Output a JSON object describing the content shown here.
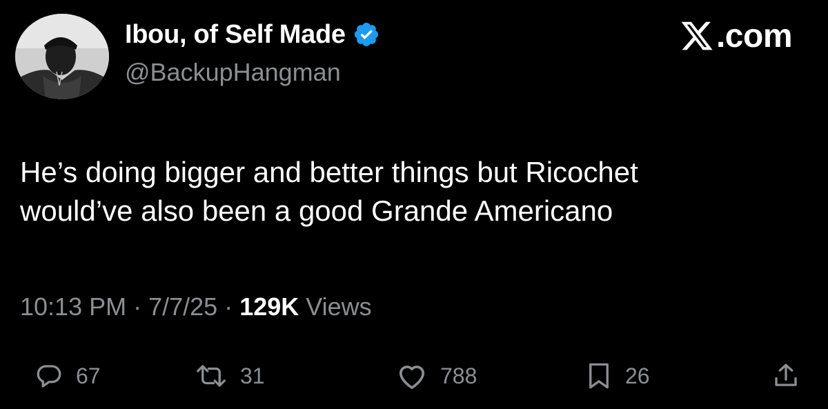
{
  "author": {
    "display_name": "Ibou, of Self Made",
    "handle": "@BackupHangman",
    "avatar_icon": "user-photo-avatar",
    "verified_icon": "verified-badge-icon"
  },
  "brand": {
    "suffix": ".com",
    "logo_icon": "x-logo-icon"
  },
  "tweet": {
    "text": "He’s doing bigger and better things but Ricochet\nwould’ve also been a good Grande Americano"
  },
  "meta": {
    "time": "10:13 PM",
    "separator": "·",
    "date": "7/7/25",
    "views_count": "129K",
    "views_label": "Views"
  },
  "actions": {
    "replies": "67",
    "reposts": "31",
    "likes": "788",
    "bookmarks": "26"
  },
  "colors": {
    "background": "#000000",
    "primary_text": "#ffffff",
    "secondary_text": "#8b8f94",
    "verified_blue": "#1d9bf0"
  }
}
